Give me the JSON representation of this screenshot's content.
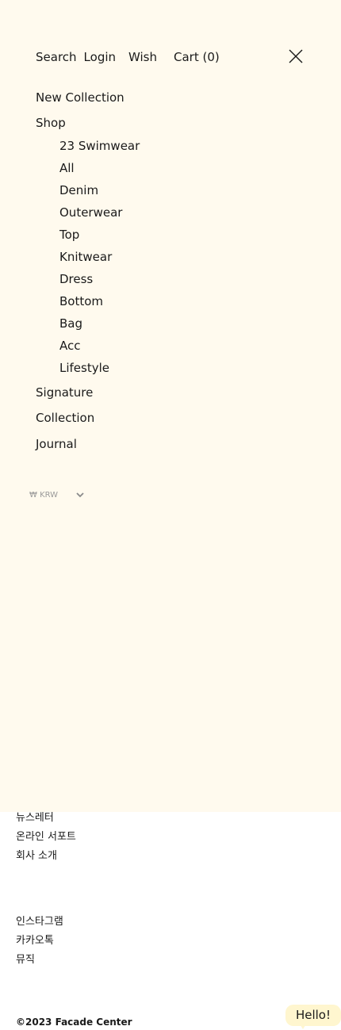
{
  "topbar": {
    "search_label": "Search",
    "login_label": "Login",
    "wish_label": "Wish",
    "cart_label": "Cart (0)"
  },
  "nav": {
    "new_collection": "New Collection",
    "shop": "Shop",
    "shop_items": [
      "23 Swimwear",
      "All",
      "Denim",
      "Outerwear",
      "Top",
      "Knitwear",
      "Dress",
      "Bottom",
      "Bag",
      "Acc",
      "Lifestyle"
    ],
    "signature": "Signature",
    "collection": "Collection",
    "journal": "Journal"
  },
  "currency": {
    "selected": "₩ KRW"
  },
  "footer": {
    "group1": [
      "뉴스레터",
      "온라인 서포트",
      "회사 소개"
    ],
    "group2": [
      "인스타그램",
      "카카오톡",
      "뮤직"
    ],
    "copyright": "©2023 Facade Center"
  },
  "chat": {
    "label": "Hello!"
  },
  "colors": {
    "menu_background": "#fffaee",
    "page_background": "#ffffff",
    "chat_bubble": "#fff6cf"
  },
  "icons": {
    "close": "close-icon",
    "currency_dropdown": "chevron-down-icon"
  }
}
